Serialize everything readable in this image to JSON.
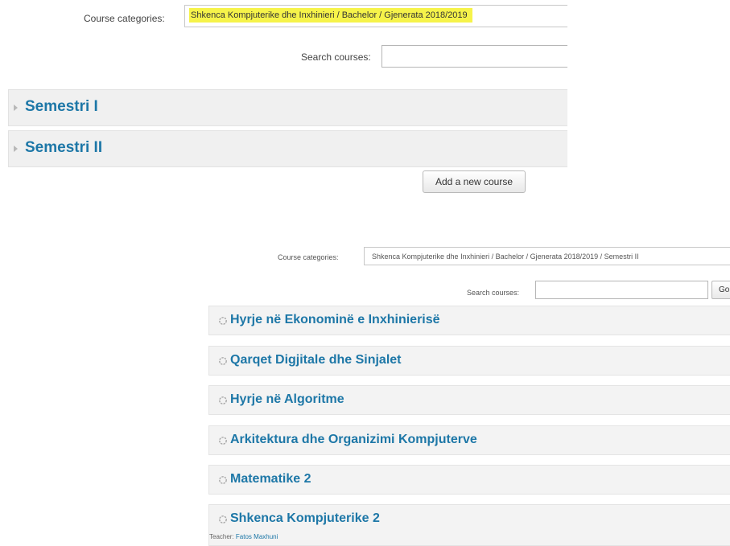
{
  "top_panel": {
    "category_label": "Course categories:",
    "category_value": "Shkenca Kompjuterike dhe Inxhinieri / Bachelor / Gjenerata 2018/2019",
    "search_label": "Search courses:",
    "search_value": "",
    "categories": [
      {
        "name": "Semestri I"
      },
      {
        "name": "Semestri II"
      }
    ],
    "add_button_label": "Add a new course"
  },
  "bottom_panel": {
    "category_label": "Course categories:",
    "category_value": "Shkenca Kompjuterike dhe Inxhinieri / Bachelor / Gjenerata 2018/2019 / Semestri II",
    "search_label": "Search courses:",
    "search_value": "",
    "go_button_label": "Go",
    "courses": [
      {
        "name": "Hyrje në Ekonominë e Inxhinierisë"
      },
      {
        "name": "Qarqet Digjitale dhe Sinjalet"
      },
      {
        "name": "Hyrje në Algoritme"
      },
      {
        "name": "Arkitektura dhe Organizimi Kompjuterve"
      },
      {
        "name": "Matematike 2"
      },
      {
        "name": "Shkenca Kompjuterike 2",
        "teacher_label": "Teacher:",
        "teacher_name": "Fatos Maxhuni"
      }
    ]
  },
  "colors": {
    "link_blue": "#1d77a7",
    "highlight_yellow": "#f6f34a",
    "row_bg": "#f0f0f0"
  },
  "icons": {
    "category_expand": "triangle-right-icon",
    "course": "course-icon"
  }
}
